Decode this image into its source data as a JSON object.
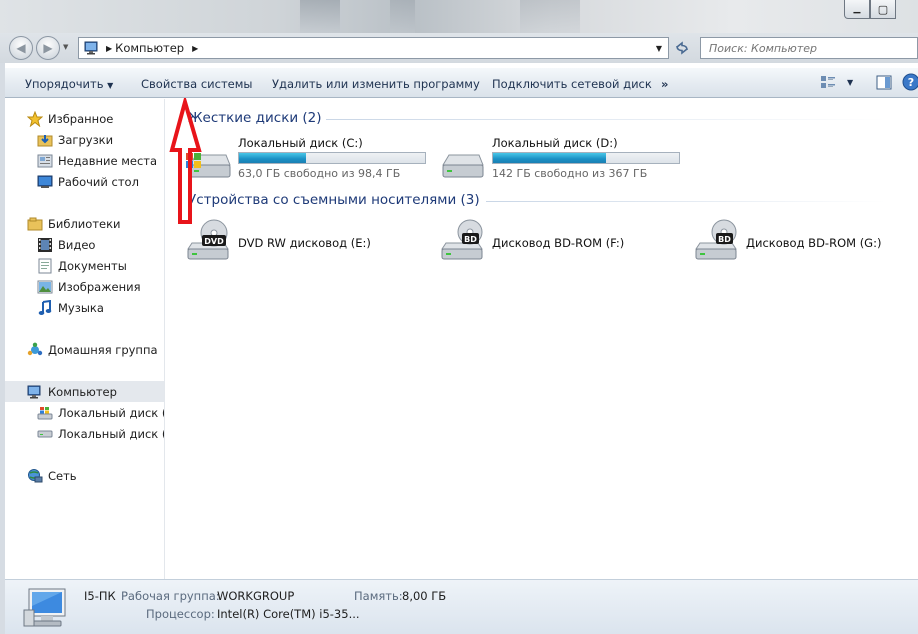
{
  "window": {
    "minimize_glyph": "▁",
    "maximize_glyph": "▢"
  },
  "address_bar": {
    "crumb": "Компьютер",
    "search_placeholder": "Поиск: Компьютер"
  },
  "toolbar": {
    "organize": "Упорядочить",
    "system_properties": "Свойства системы",
    "uninstall": "Удалить или изменить программу",
    "map_drive": "Подключить сетевой диск",
    "more": "»"
  },
  "nav": {
    "favorites": "Избранное",
    "downloads": "Загрузки",
    "recent": "Недавние места",
    "desktop": "Рабочий стол",
    "libraries": "Библиотеки",
    "video": "Видео",
    "documents": "Документы",
    "pictures": "Изображения",
    "music": "Музыка",
    "homegroup": "Домашняя группа",
    "computer": "Компьютер",
    "disk_c": "Локальный диск (C",
    "disk_d": "Локальный диск (D",
    "network": "Сеть"
  },
  "groups": {
    "hard_disks": "Жесткие диски (2)",
    "removable": "Устройства со съемными носителями (3)"
  },
  "drives": [
    {
      "name": "Локальный диск (C:)",
      "free": "63,0 ГБ свободно из 98,4 ГБ",
      "used_fraction": 0.36
    },
    {
      "name": "Локальный диск (D:)",
      "free": "142 ГБ свободно из 367 ГБ",
      "used_fraction": 0.61
    }
  ],
  "removable": [
    {
      "name": "DVD RW дисковод (E:)",
      "badge": "DVD"
    },
    {
      "name": "Дисковод BD-ROM (F:)",
      "badge": "BD"
    },
    {
      "name": "Дисковод BD-ROM (G:)",
      "badge": "BD"
    }
  ],
  "status": {
    "pc_name": "I5-ПК",
    "workgroup_label": "Рабочая группа:",
    "workgroup": "WORKGROUP",
    "memory_label": "Память:",
    "memory": "8,00 ГБ",
    "cpu_label": "Процессор:",
    "cpu": "Intel(R) Core(TM) i5-35..."
  },
  "colors": {
    "group_header": "#1e3a78",
    "bar_fill": "#1b90c4",
    "annotation_arrow": "#e8141a"
  }
}
